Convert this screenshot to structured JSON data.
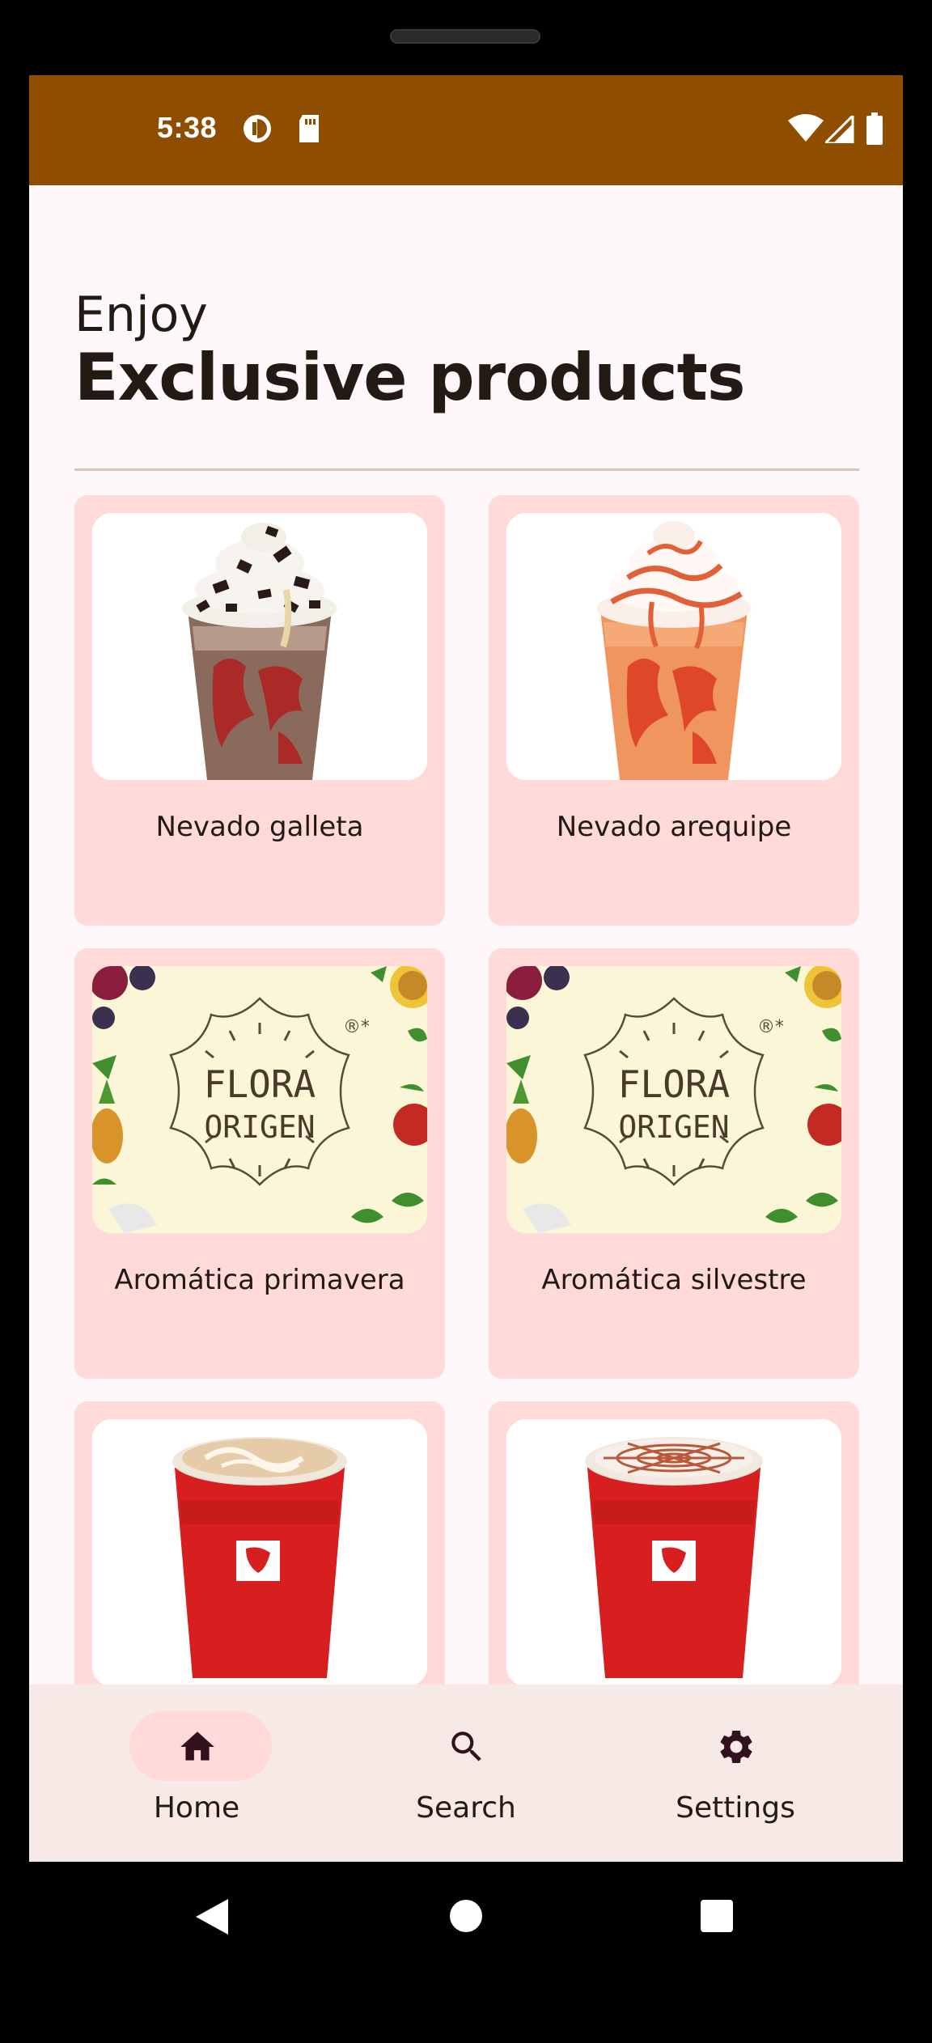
{
  "status_bar": {
    "time": "5:38",
    "color": "#8F4D00",
    "left_icons": [
      "data-saver-icon",
      "sd-card-icon"
    ],
    "right_icons": [
      "wifi-icon",
      "signal-icon",
      "battery-icon"
    ]
  },
  "header": {
    "subtitle": "Enjoy",
    "title": "Exclusive products"
  },
  "products": [
    {
      "name": "Nevado galleta",
      "image": "cookie-milkshake"
    },
    {
      "name": "Nevado arequipe",
      "image": "caramel-milkshake"
    },
    {
      "name": "Aromática primavera",
      "image": "flora-origen-logo"
    },
    {
      "name": "Aromática silvestre",
      "image": "flora-origen-logo"
    },
    {
      "name": "",
      "image": "latte-red-cup"
    },
    {
      "name": "",
      "image": "caramel-latte-red-cup"
    }
  ],
  "flora_logo": {
    "line1": "FLORA",
    "line2": "ORIGEN",
    "mark": "®*"
  },
  "bottom_nav": {
    "items": [
      {
        "label": "Home",
        "icon": "home-icon",
        "active": true
      },
      {
        "label": "Search",
        "icon": "search-icon",
        "active": false
      },
      {
        "label": "Settings",
        "icon": "gear-icon",
        "active": false
      }
    ]
  },
  "colors": {
    "card_background": "#FFDAD8",
    "screen_background": "#FFF8FA",
    "nav_background": "#F6E9E6",
    "text": "#231A14"
  }
}
